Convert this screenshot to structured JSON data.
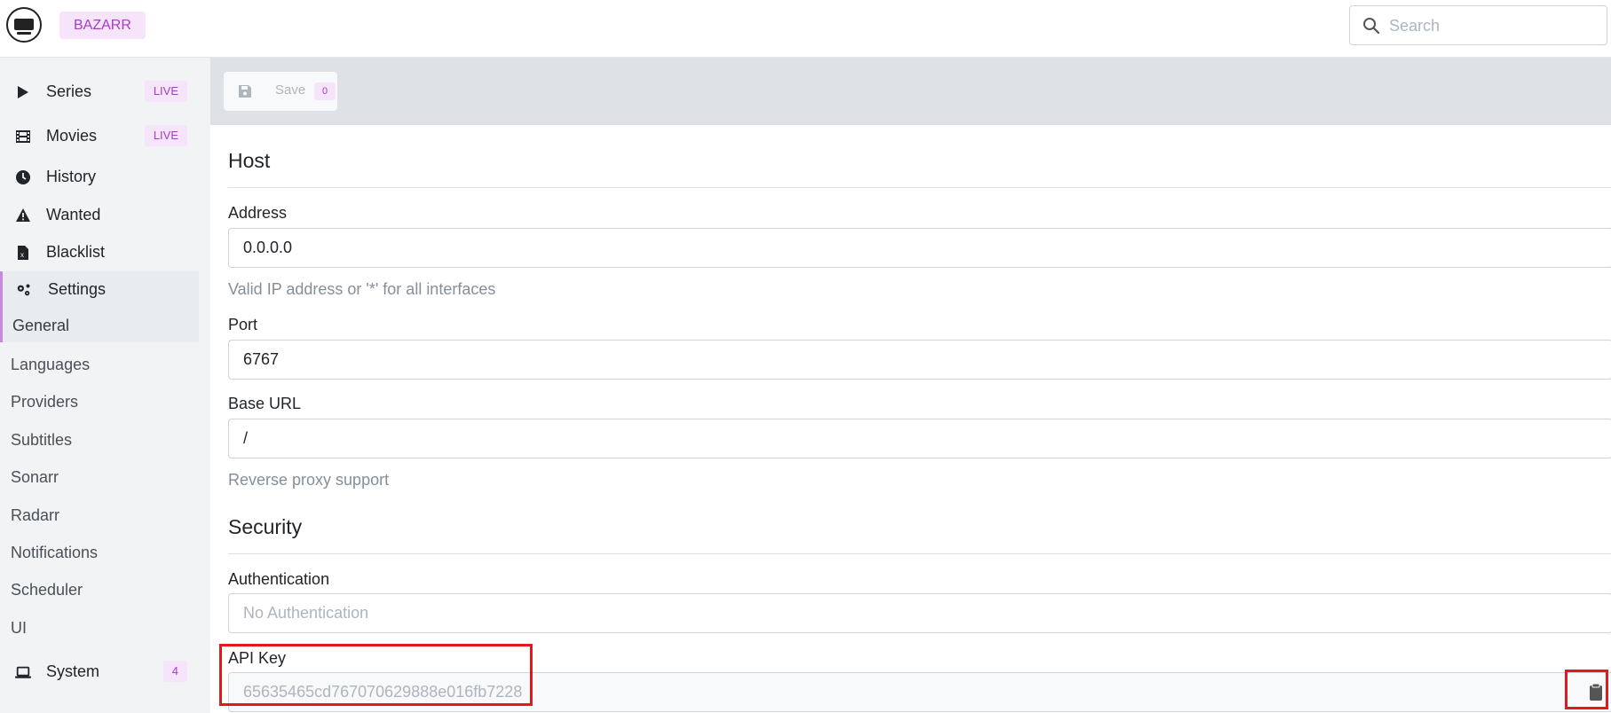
{
  "header": {
    "brand": "BAZARR",
    "search_placeholder": "Search"
  },
  "sidebar": {
    "items": [
      {
        "label": "Series",
        "badge": "LIVE"
      },
      {
        "label": "Movies",
        "badge": "LIVE"
      },
      {
        "label": "History"
      },
      {
        "label": "Wanted"
      },
      {
        "label": "Blacklist"
      },
      {
        "label": "Settings"
      }
    ],
    "settings_sub": [
      "General",
      "Languages",
      "Providers",
      "Subtitles",
      "Sonarr",
      "Radarr",
      "Notifications",
      "Scheduler",
      "UI"
    ],
    "system": {
      "label": "System",
      "badge": "4"
    }
  },
  "toolbar": {
    "save_label": "Save",
    "save_count": "0"
  },
  "host": {
    "title": "Host",
    "address_label": "Address",
    "address_value": "0.0.0.0",
    "address_help": "Valid IP address or '*' for all interfaces",
    "port_label": "Port",
    "port_value": "6767",
    "baseurl_label": "Base URL",
    "baseurl_value": "/",
    "baseurl_help": "Reverse proxy support"
  },
  "security": {
    "title": "Security",
    "auth_label": "Authentication",
    "auth_value": "No Authentication",
    "apikey_label": "API Key",
    "apikey_value": "65635465cd767070629888e016fb7228"
  },
  "colors": {
    "accent": "#a33fc4",
    "accent_bg": "#f6e4fb",
    "highlight": "#e01a1a"
  }
}
